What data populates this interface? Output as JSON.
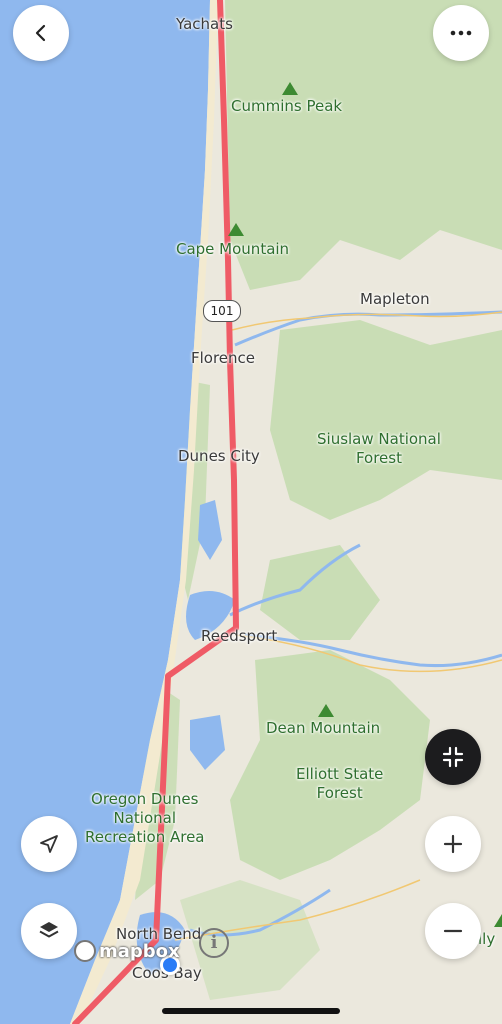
{
  "map": {
    "places": [
      {
        "name": "Yachats",
        "kind": "town"
      },
      {
        "name": "Cummins Peak",
        "kind": "peak"
      },
      {
        "name": "Cape Mountain",
        "kind": "peak"
      },
      {
        "name": "Mapleton",
        "kind": "town"
      },
      {
        "name": "Florence",
        "kind": "town"
      },
      {
        "name": "Siuslaw National\nForest",
        "kind": "forest"
      },
      {
        "name": "Dunes City",
        "kind": "town"
      },
      {
        "name": "Reedsport",
        "kind": "town"
      },
      {
        "name": "Dean Mountain",
        "kind": "peak"
      },
      {
        "name": "Elliott State\nForest",
        "kind": "forest"
      },
      {
        "name": "Oregon Dunes\nNational\nRecreation Area",
        "kind": "forest"
      },
      {
        "name": "North Bend",
        "kind": "town"
      },
      {
        "name": "Coos Bay",
        "kind": "town"
      },
      {
        "name": "lly",
        "kind": "partial"
      }
    ],
    "highway_shield": "101",
    "route_color": "#ef5b66",
    "water_color": "#8fb8ee",
    "forest_color": "#c6dcb0",
    "attribution": {
      "brand": "mapbox",
      "info": "i"
    }
  },
  "controls": {
    "back": "back-chevron-icon",
    "more": "more-dots-icon",
    "collapse": "collapse-arrows-icon",
    "locate": "navigation-arrow-icon",
    "zoom_in": "plus-icon",
    "zoom_out": "minus-icon",
    "layers": "layers-icon"
  }
}
